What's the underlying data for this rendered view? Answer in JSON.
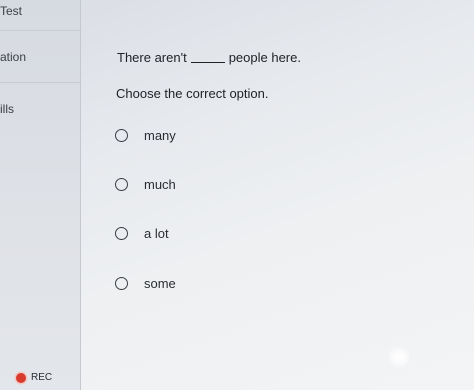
{
  "sidebar": {
    "items": [
      {
        "label": "Test"
      },
      {
        "label": "ation"
      },
      {
        "label": "ills"
      }
    ]
  },
  "question": {
    "prefix": "There aren't",
    "suffix": "people here."
  },
  "instruction": "Choose the correct option.",
  "options": [
    {
      "label": "many"
    },
    {
      "label": "much"
    },
    {
      "label": "a lot"
    },
    {
      "label": "some"
    }
  ],
  "recording": {
    "label": "REC",
    "color": "#d83a2e"
  }
}
